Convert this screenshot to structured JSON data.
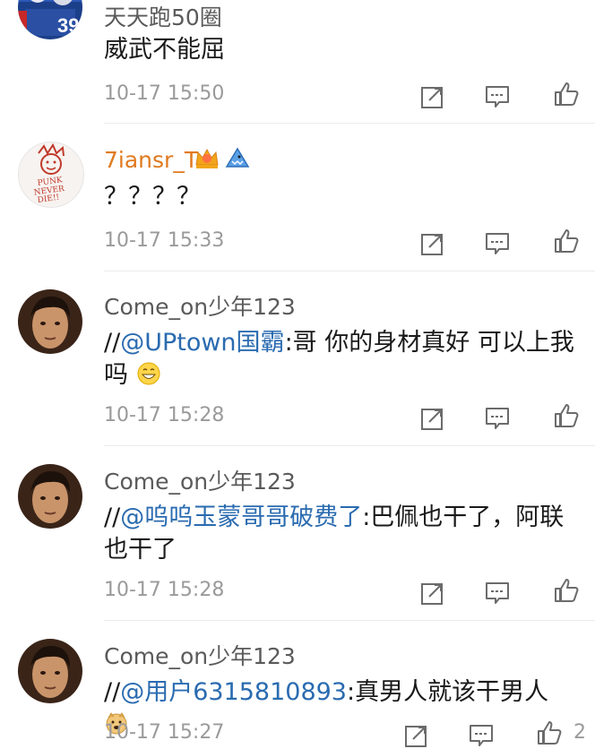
{
  "comments": [
    {
      "user": "天天跑50圈",
      "text": "威武不能屈",
      "time": "10-17 15:50"
    },
    {
      "user": "7iansr_T",
      "text": "？？？？",
      "time": "10-17 15:33",
      "avatar_text": "PUNK NEVER DIE!!"
    },
    {
      "user": "Come_on少年123",
      "prefix": "//",
      "mention": "@UPtown国霸",
      "text": ":哥 你的身材真好 可以上我吗",
      "time": "10-17 15:28"
    },
    {
      "user": "Come_on少年123",
      "prefix": "//",
      "mention": "@呜呜玉蒙哥哥破费了",
      "text": ":巴佩也干了，阿联也干了",
      "time": "10-17 15:28"
    },
    {
      "user": "Come_on少年123",
      "prefix": "//",
      "mention": "@用户6315810893",
      "text": ":真男人就该干男人",
      "time": "10-17 15:27",
      "like_count": "2"
    }
  ],
  "colors": {
    "mention": "#2a6bb0",
    "username_vip": "#e07a1f",
    "meta": "#9a9a9a"
  }
}
